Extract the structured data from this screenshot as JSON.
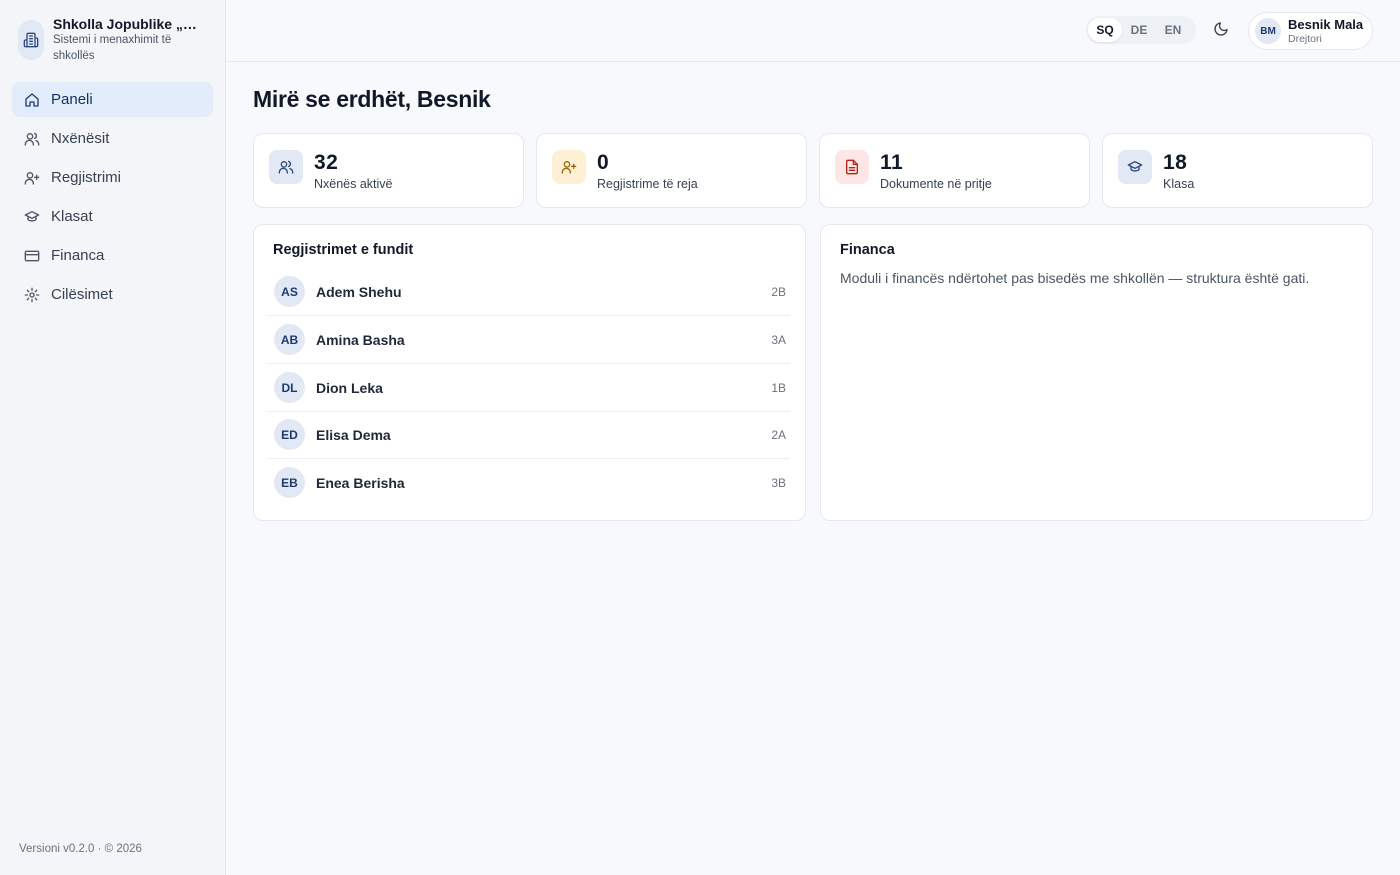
{
  "brand": {
    "title": "Shkolla Jopublike „Ha…",
    "subtitle": "Sistemi i menaxhimit të shkollës",
    "icon": "building-icon"
  },
  "nav": {
    "items": [
      {
        "label": "Paneli",
        "icon": "home-icon",
        "active": true
      },
      {
        "label": "Nxënësit",
        "icon": "users-icon",
        "active": false
      },
      {
        "label": "Regjistrimi",
        "icon": "user-plus-icon",
        "active": false
      },
      {
        "label": "Klasat",
        "icon": "graduation-cap-icon",
        "active": false
      },
      {
        "label": "Financa",
        "icon": "credit-card-icon",
        "active": false
      },
      {
        "label": "Cilësimet",
        "icon": "gear-icon",
        "active": false
      }
    ]
  },
  "footer": {
    "version": "Versioni v0.2.0 · © 2026"
  },
  "topbar": {
    "languages": [
      "SQ",
      "DE",
      "EN"
    ],
    "active_language": "SQ",
    "theme_icon": "moon-icon",
    "user": {
      "initials": "BM",
      "name": "Besnik Mala",
      "role": "Drejtori"
    }
  },
  "greeting": "Mirë se erdhët, Besnik",
  "stats": [
    {
      "value": "32",
      "label": "Nxënës aktivë",
      "icon": "users-icon",
      "color": "#e2e8f4"
    },
    {
      "value": "0",
      "label": "Regjistrime të reja",
      "icon": "user-plus-icon",
      "color": "#fdf0d5"
    },
    {
      "value": "11",
      "label": "Dokumente në pritje",
      "icon": "file-icon",
      "color": "#fde6e6"
    },
    {
      "value": "18",
      "label": "Klasa",
      "icon": "graduation-cap-icon",
      "color": "#e2e8f4"
    }
  ],
  "recent": {
    "title": "Regjistrimet e fundit",
    "rows": [
      {
        "initials": "AS",
        "name": "Adem Shehu",
        "class": "2B"
      },
      {
        "initials": "AB",
        "name": "Amina Basha",
        "class": "3A"
      },
      {
        "initials": "DL",
        "name": "Dion Leka",
        "class": "1B"
      },
      {
        "initials": "ED",
        "name": "Elisa Dema",
        "class": "2A"
      },
      {
        "initials": "EB",
        "name": "Enea Berisha",
        "class": "3B"
      }
    ]
  },
  "finance": {
    "title": "Financa",
    "text": "Moduli i financës ndërtohet pas bisedës me shkollën — struktura është gati."
  }
}
